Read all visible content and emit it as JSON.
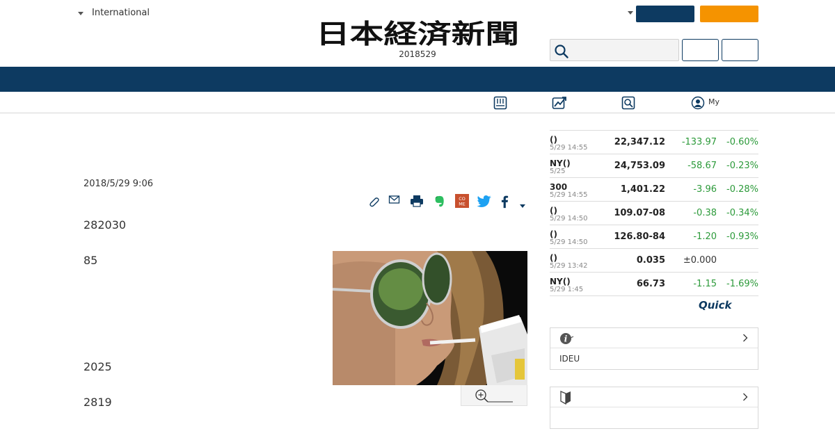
{
  "header": {
    "edition_label": "International",
    "logo_text": "日本経済新聞",
    "date": "2018529"
  },
  "subnav": {
    "my_label": "My"
  },
  "article": {
    "timestamp": "2018/5/29 9:06",
    "paragraphs": [
      "282030",
      "85",
      "2025",
      "2819"
    ]
  },
  "market": {
    "rows": [
      {
        "name": "()",
        "time": "5/29 14:55",
        "price": "22,347.12",
        "change": "-133.97",
        "pct": "-0.60%"
      },
      {
        "name": "NY()",
        "time": "5/25",
        "price": "24,753.09",
        "change": "-58.67",
        "pct": "-0.23%"
      },
      {
        "name": "300",
        "time": "5/29 14:55",
        "price": "1,401.22",
        "change": "-3.96",
        "pct": "-0.28%"
      },
      {
        "name": "()",
        "time": "5/29 14:50",
        "price": "109.07-08",
        "change": "-0.38",
        "pct": "-0.34%"
      },
      {
        "name": "()",
        "time": "5/29 14:50",
        "price": "126.80-84",
        "change": "-1.20",
        "pct": "-0.93%"
      },
      {
        "name": "()",
        "time": "5/29 13:42",
        "price": "0.035",
        "change": "±0.000",
        "pct": ""
      },
      {
        "name": "NY()",
        "time": "5/29 1:45",
        "price": "66.73",
        "change": "-1.15",
        "pct": "-1.69%"
      }
    ],
    "quick_logo": "Quick"
  },
  "info_box": {
    "body_text": "IDEU"
  },
  "colors": {
    "navy": "#0d3a61",
    "orange": "#f59300",
    "down_green": "#2c9a3a"
  },
  "icons": [
    "search-icon",
    "newspaper-icon",
    "chart-icon",
    "search-paper-icon",
    "user-icon",
    "clip-icon",
    "mail-icon",
    "print-icon",
    "evernote-icon",
    "come-icon",
    "twitter-icon",
    "facebook-icon",
    "zoom-in-icon",
    "info-icon",
    "chevron-right-icon",
    "beginner-mark-icon"
  ]
}
